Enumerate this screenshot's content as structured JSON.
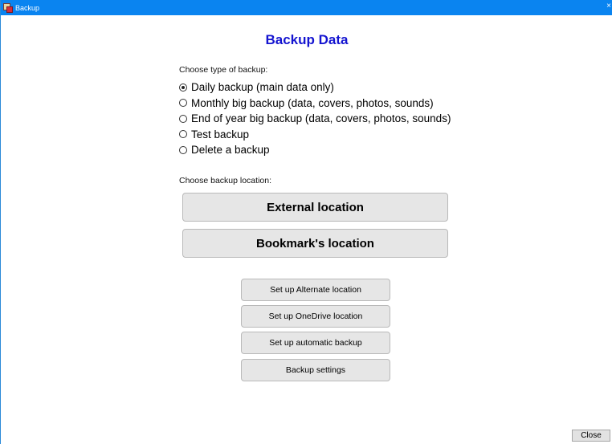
{
  "window": {
    "title": "Backup",
    "close_glyph": "×",
    "icon": "backup-app-icon",
    "titlebar_color": "#0a84f0"
  },
  "heading": {
    "text": "Backup Data",
    "color": "#1414d0"
  },
  "backup_type": {
    "label": "Choose type of backup:",
    "options": [
      {
        "label": "Daily backup (main data only)",
        "selected": true
      },
      {
        "label": "Monthly big backup (data, covers, photos, sounds)",
        "selected": false
      },
      {
        "label": "End of year big backup (data, covers, photos, sounds)",
        "selected": false
      },
      {
        "label": "Test backup",
        "selected": false
      },
      {
        "label": "Delete a backup",
        "selected": false
      }
    ]
  },
  "location": {
    "label": "Choose backup location:",
    "external_label": "External location",
    "bookmark_label": "Bookmark's location"
  },
  "setup": {
    "alternate_label": "Set up Alternate location",
    "onedrive_label": "Set up OneDrive location",
    "automatic_label": "Set up automatic backup",
    "settings_label": "Backup settings"
  },
  "footer": {
    "close_label": "Close"
  }
}
